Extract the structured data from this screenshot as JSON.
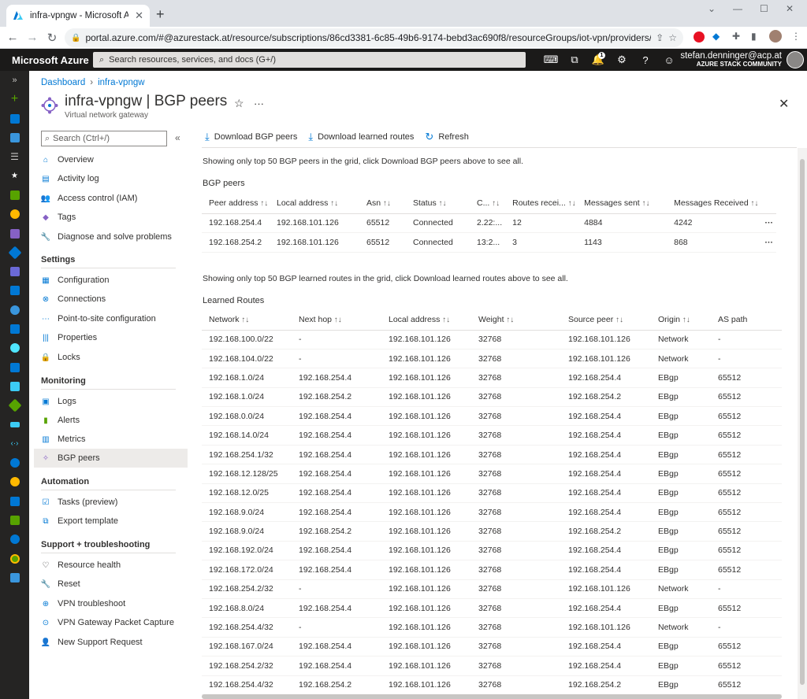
{
  "browser": {
    "tab_title": "infra-vpngw - Microsoft Azure",
    "url": "portal.azure.com/#@azurestack.at/resource/subscriptions/86cd3381-6c85-49b6-9174-bebd3ac690f8/resourceGroups/iot-vpn/providers/Microsoft.N..."
  },
  "azure": {
    "brand": "Microsoft Azure",
    "search_placeholder": "Search resources, services, and docs (G+/)",
    "notification_count": "1",
    "user_name": "stefan.denninger@acp.at",
    "user_directory": "AZURE STACK COMMUNITY"
  },
  "breadcrumb": [
    "Dashboard",
    "infra-vpngw"
  ],
  "header": {
    "title": "infra-vpngw | BGP peers",
    "subtitle": "Virtual network gateway"
  },
  "menu": {
    "search_placeholder": "Search (Ctrl+/)",
    "top": [
      "Overview",
      "Activity log",
      "Access control (IAM)",
      "Tags",
      "Diagnose and solve problems"
    ],
    "settings_title": "Settings",
    "settings": [
      "Configuration",
      "Connections",
      "Point-to-site configuration",
      "Properties",
      "Locks"
    ],
    "monitoring_title": "Monitoring",
    "monitoring": [
      "Logs",
      "Alerts",
      "Metrics",
      "BGP peers"
    ],
    "automation_title": "Automation",
    "automation": [
      "Tasks (preview)",
      "Export template"
    ],
    "support_title": "Support + troubleshooting",
    "support": [
      "Resource health",
      "Reset",
      "VPN troubleshoot",
      "VPN Gateway Packet Capture",
      "New Support Request"
    ]
  },
  "toolbar": {
    "download_peers": "Download BGP peers",
    "download_routes": "Download learned routes",
    "refresh": "Refresh"
  },
  "notes": {
    "peers": "Showing only top 50 BGP peers in the grid, click Download BGP peers above to see all.",
    "routes": "Showing only top 50 BGP learned routes in the grid, click Download learned routes above to see all."
  },
  "peers": {
    "heading": "BGP peers",
    "columns": [
      "Peer address",
      "Local address",
      "Asn",
      "Status",
      "C...",
      "Routes recei...",
      "Messages sent",
      "Messages Received"
    ],
    "rows": [
      [
        "192.168.254.4",
        "192.168.101.126",
        "65512",
        "Connected",
        "2.22:...",
        "12",
        "4884",
        "4242"
      ],
      [
        "192.168.254.2",
        "192.168.101.126",
        "65512",
        "Connected",
        "13:2...",
        "3",
        "1143",
        "868"
      ]
    ]
  },
  "routes": {
    "heading": "Learned Routes",
    "columns": [
      "Network",
      "Next hop",
      "Local address",
      "Weight",
      "Source peer",
      "Origin",
      "AS path"
    ],
    "rows": [
      [
        "192.168.100.0/22",
        "-",
        "192.168.101.126",
        "32768",
        "192.168.101.126",
        "Network",
        "-"
      ],
      [
        "192.168.104.0/22",
        "-",
        "192.168.101.126",
        "32768",
        "192.168.101.126",
        "Network",
        "-"
      ],
      [
        "192.168.1.0/24",
        "192.168.254.4",
        "192.168.101.126",
        "32768",
        "192.168.254.4",
        "EBgp",
        "65512"
      ],
      [
        "192.168.1.0/24",
        "192.168.254.2",
        "192.168.101.126",
        "32768",
        "192.168.254.2",
        "EBgp",
        "65512"
      ],
      [
        "192.168.0.0/24",
        "192.168.254.4",
        "192.168.101.126",
        "32768",
        "192.168.254.4",
        "EBgp",
        "65512"
      ],
      [
        "192.168.14.0/24",
        "192.168.254.4",
        "192.168.101.126",
        "32768",
        "192.168.254.4",
        "EBgp",
        "65512"
      ],
      [
        "192.168.254.1/32",
        "192.168.254.4",
        "192.168.101.126",
        "32768",
        "192.168.254.4",
        "EBgp",
        "65512"
      ],
      [
        "192.168.12.128/25",
        "192.168.254.4",
        "192.168.101.126",
        "32768",
        "192.168.254.4",
        "EBgp",
        "65512"
      ],
      [
        "192.168.12.0/25",
        "192.168.254.4",
        "192.168.101.126",
        "32768",
        "192.168.254.4",
        "EBgp",
        "65512"
      ],
      [
        "192.168.9.0/24",
        "192.168.254.4",
        "192.168.101.126",
        "32768",
        "192.168.254.4",
        "EBgp",
        "65512"
      ],
      [
        "192.168.9.0/24",
        "192.168.254.2",
        "192.168.101.126",
        "32768",
        "192.168.254.2",
        "EBgp",
        "65512"
      ],
      [
        "192.168.192.0/24",
        "192.168.254.4",
        "192.168.101.126",
        "32768",
        "192.168.254.4",
        "EBgp",
        "65512"
      ],
      [
        "192.168.172.0/24",
        "192.168.254.4",
        "192.168.101.126",
        "32768",
        "192.168.254.4",
        "EBgp",
        "65512"
      ],
      [
        "192.168.254.2/32",
        "-",
        "192.168.101.126",
        "32768",
        "192.168.101.126",
        "Network",
        "-"
      ],
      [
        "192.168.8.0/24",
        "192.168.254.4",
        "192.168.101.126",
        "32768",
        "192.168.254.4",
        "EBgp",
        "65512"
      ],
      [
        "192.168.254.4/32",
        "-",
        "192.168.101.126",
        "32768",
        "192.168.101.126",
        "Network",
        "-"
      ],
      [
        "192.168.167.0/24",
        "192.168.254.4",
        "192.168.101.126",
        "32768",
        "192.168.254.4",
        "EBgp",
        "65512"
      ],
      [
        "192.168.254.2/32",
        "192.168.254.4",
        "192.168.101.126",
        "32768",
        "192.168.254.4",
        "EBgp",
        "65512"
      ],
      [
        "192.168.254.4/32",
        "192.168.254.2",
        "192.168.101.126",
        "32768",
        "192.168.254.2",
        "EBgp",
        "65512"
      ]
    ]
  },
  "colors": {
    "azure_blue": "#0078d4",
    "topbar": "#1b1a19",
    "rail": "#252423",
    "selected": "#edebe9"
  }
}
